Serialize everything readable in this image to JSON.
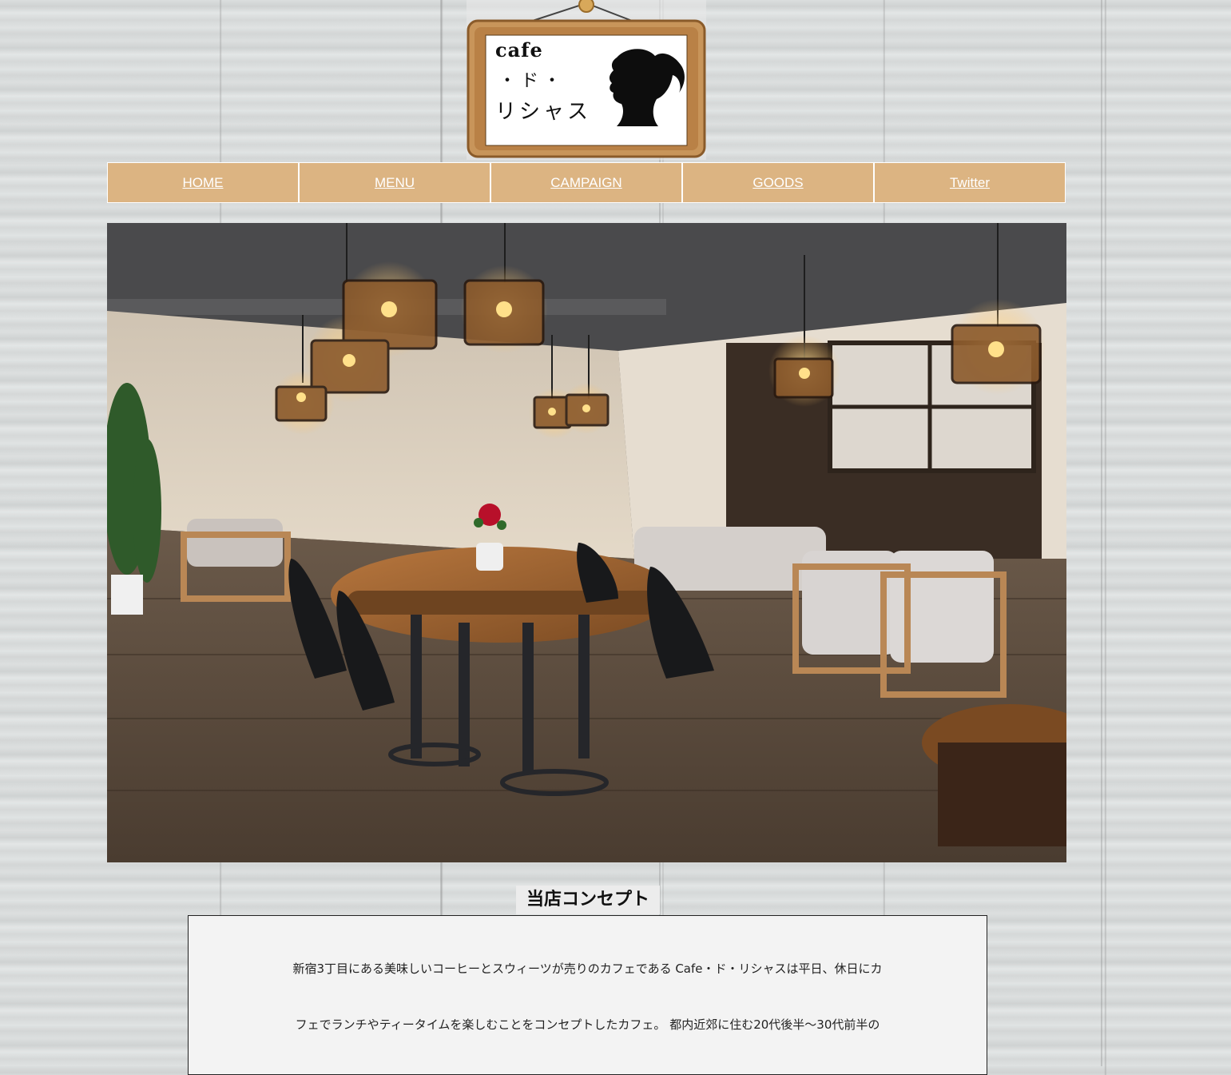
{
  "logo": {
    "line1": "cafe",
    "line2": "・ド・",
    "line3": "リシャス",
    "image": "silhouette-woman-logo"
  },
  "nav": {
    "items": [
      {
        "label": "HOME"
      },
      {
        "label": "MENU"
      },
      {
        "label": "CAMPAIGN"
      },
      {
        "label": "GOODS"
      },
      {
        "label": "Twitter"
      }
    ]
  },
  "hero": {
    "image": "cafe-interior-photo"
  },
  "concept": {
    "title": "当店コンセプト",
    "lines": [
      "新宿3丁目にある美味しいコーヒーとスウィーツが売りのカフェである Cafe・ド・リシャスは平日、休日にカ",
      "フェでランチやティータイムを楽しむことをコンセプトしたカフェ。 都内近郊に住む20代後半〜30代前半の"
    ]
  },
  "colors": {
    "nav_bg": "#dcb482",
    "nav_text": "#ffffff",
    "concept_bg": "#f3f3f3"
  }
}
